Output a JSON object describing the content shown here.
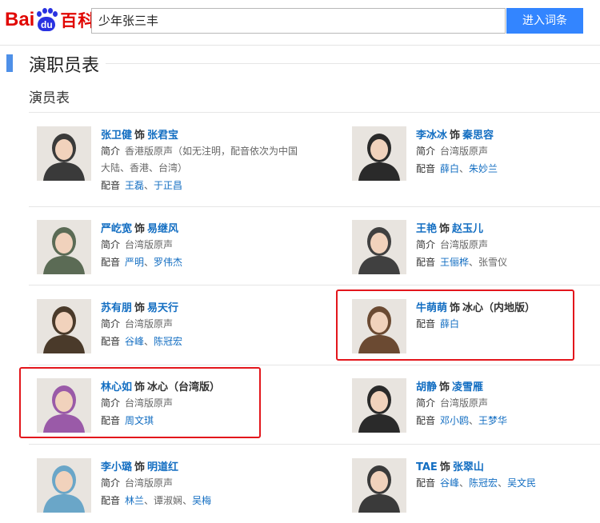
{
  "header": {
    "logo_bai": "Bai",
    "logo_du": "du",
    "logo_baike": "百科",
    "search_value": "少年张三丰",
    "search_button": "进入词条"
  },
  "section": {
    "title": "演职员表",
    "subtitle": "演员表"
  },
  "labels": {
    "shi": "饰",
    "intro": "简介",
    "dub": "配音",
    "sep": "、"
  },
  "cast": [
    {
      "actor": "张卫健",
      "role": "张君宝",
      "intro": "香港版原声（如无注明，配音依次为中国大陆、香港、台湾）",
      "dubbers": [
        "王磊",
        "于正昌"
      ],
      "accent": "#3a3a3a"
    },
    {
      "actor": "李冰冰",
      "role": "秦思容",
      "intro": "台湾版原声",
      "dubbers": [
        "薛白",
        "朱妙兰"
      ],
      "accent": "#2a2a2a"
    },
    {
      "actor": "严屹宽",
      "role": "易继风",
      "intro": "台湾版原声",
      "dubbers": [
        "严明",
        "罗伟杰"
      ],
      "accent": "#5b6b55"
    },
    {
      "actor": "王艳",
      "role": "赵玉儿",
      "intro": "台湾版原声",
      "dubbers": [
        "王俪桦",
        "张雪仪"
      ],
      "dubbers_plain": [
        false,
        true
      ],
      "accent": "#404040"
    },
    {
      "actor": "苏有朋",
      "role": "易天行",
      "intro": "台湾版原声",
      "dubbers": [
        "谷峰",
        "陈冠宏"
      ],
      "accent": "#4a3a2a"
    },
    {
      "actor": "牛萌萌",
      "role": "冰心（内地版）",
      "dubbers": [
        "薛白"
      ],
      "accent": "#6b4a32"
    },
    {
      "actor": "林心如",
      "role": "冰心（台湾版）",
      "intro": "台湾版原声",
      "dubbers": [
        "周文琪"
      ],
      "accent": "#9a5aa8"
    },
    {
      "actor": "胡静",
      "role": "凌雪雁",
      "intro": "台湾版原声",
      "dubbers": [
        "邓小鸥",
        "王梦华"
      ],
      "accent": "#2a2a2a"
    },
    {
      "actor": "李小璐",
      "role": "明道红",
      "intro": "台湾版原声",
      "dubbers": [
        "林兰",
        "谭淑娴",
        "吴梅"
      ],
      "dubbers_plain": [
        false,
        true,
        false
      ],
      "accent": "#6aa6c8"
    },
    {
      "actor": "TAE",
      "role": "张翠山",
      "dubbers": [
        "谷峰",
        "陈冠宏",
        "吴文民"
      ],
      "accent": "#3a3a3a"
    }
  ]
}
